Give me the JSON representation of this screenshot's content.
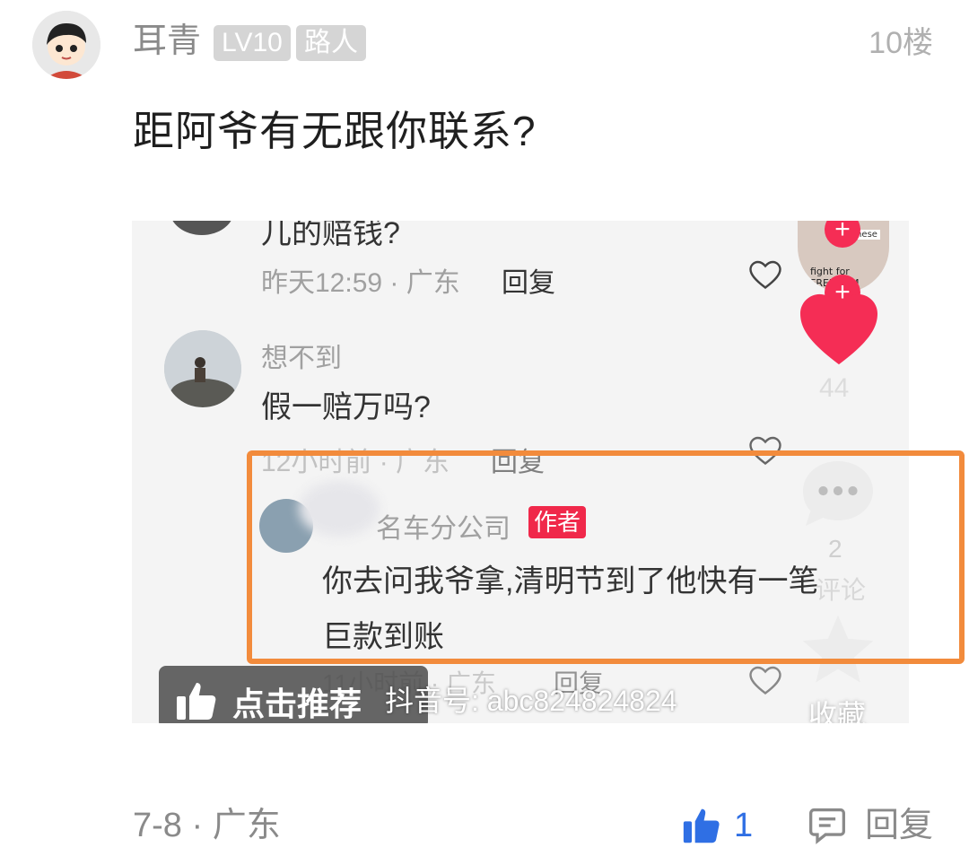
{
  "post": {
    "username": "耳青",
    "level_badge": "LV10",
    "role_badge": "路人",
    "floor": "10楼",
    "content": "距阿爷有无跟你联系?",
    "date_location": "7-8 · 广东",
    "like_count": "1",
    "reply_label": "回复"
  },
  "screenshot": {
    "top_partial_text": "儿的赔钱?",
    "comment1_meta": "昨天12:59 · 广东",
    "comment1_reply": "回复",
    "comment2_user": "想不到",
    "comment2_text": "假一赔万吗?",
    "comment2_meta": "12小时前 · 广东",
    "comment2_reply": "回复",
    "comment3_user": "名车分公司",
    "comment3_badge": "作者",
    "comment3_text_line1": "你去问我爷拿,清明节到了他快有一笔",
    "comment3_text_line2": "巨款到账",
    "comment3_meta": "11小时前 · 广东",
    "comment3_reply": "回复",
    "side_like_count": "44",
    "side_comment_count": "2",
    "side_comment_label": "评论",
    "side_collect_label": "收藏",
    "recommend_label": "点击推荐",
    "douyin_id": "抖音号: abc824824824",
    "plus_sign": "+",
    "thumb_text1": "Chinese",
    "thumb_text2": "fight for FREEDOM"
  },
  "colors": {
    "like_blue": "#2f6fe4",
    "highlight_orange": "#f28b3c",
    "heart_red": "#f52d55",
    "author_badge": "#f0284a"
  }
}
